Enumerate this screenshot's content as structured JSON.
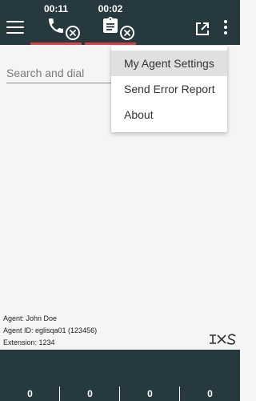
{
  "calls": [
    {
      "timer": "00:11",
      "icon": "phone-icon"
    },
    {
      "timer": "00:02",
      "icon": "clipboard-icon"
    }
  ],
  "search": {
    "placeholder": "Search and dial"
  },
  "menu": {
    "items": [
      "My Agent Settings",
      "Send Error Report",
      "About"
    ],
    "active_index": 0
  },
  "agent": {
    "name_line": "Agent: John Doe",
    "id_line": "Agent ID: eglisqa01 (123456)",
    "extension_line": "Extension: 1234"
  },
  "stats": [
    "0",
    "0",
    "0",
    "0"
  ],
  "colors": {
    "header_bg": "#26393e",
    "tab_underline": "#d64545",
    "page_bg": "#f5f5f5"
  }
}
